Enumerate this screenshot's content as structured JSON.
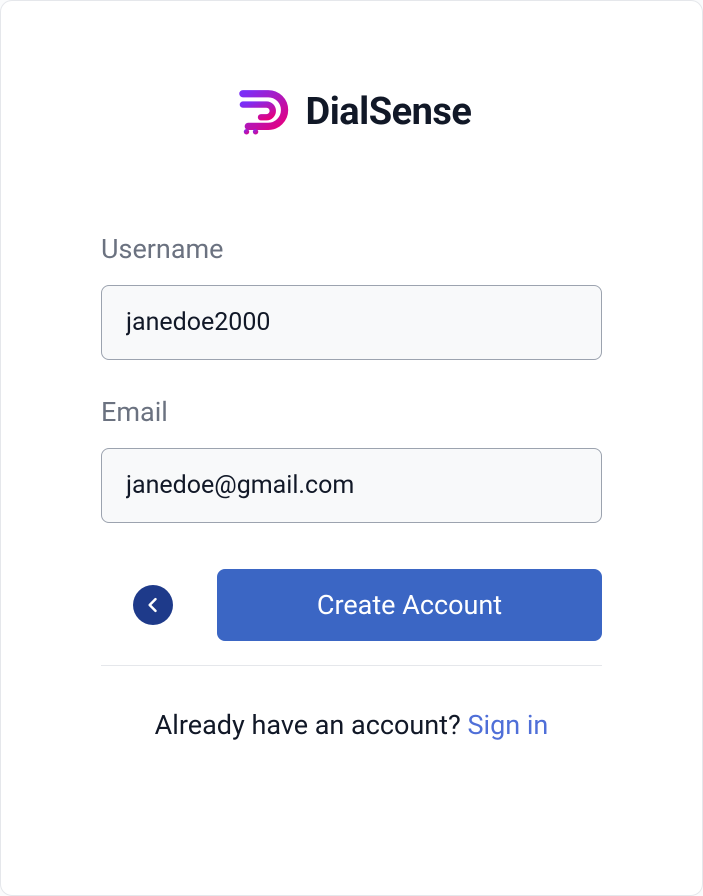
{
  "brand": {
    "name": "DialSense",
    "logo_semantic": "dialsense-logo"
  },
  "form": {
    "username": {
      "label": "Username",
      "value": "janedoe2000"
    },
    "email": {
      "label": "Email",
      "value": "janedoe@gmail.com"
    }
  },
  "actions": {
    "back_icon": "arrow-left-icon",
    "submit_label": "Create Account"
  },
  "footer": {
    "prompt_text": "Already have an account?  ",
    "signin_link_text": "Sign in"
  },
  "colors": {
    "primary_button": "#3b66c4",
    "back_button": "#1e3a8a",
    "link": "#4f6fd8",
    "input_bg": "#f8f9fa",
    "label_text": "#6b7280",
    "logo_gradient_start": "#7b2ff7",
    "logo_gradient_end": "#e6007e"
  }
}
